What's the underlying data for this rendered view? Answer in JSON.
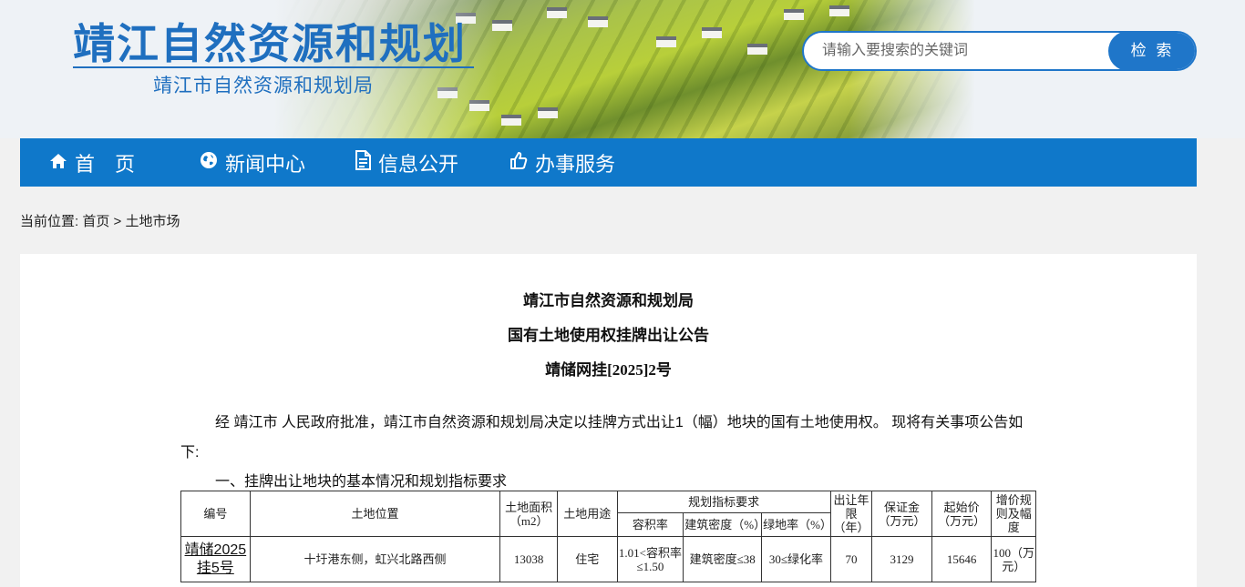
{
  "site": {
    "title": "靖江自然资源和规划",
    "subtitle": "靖江市自然资源和规划局"
  },
  "search": {
    "placeholder": "请输入要搜索的关键词",
    "button": "检 索"
  },
  "nav": {
    "items": [
      {
        "label": "首　页",
        "icon": "home-icon"
      },
      {
        "label": "新闻中心",
        "icon": "globe-icon"
      },
      {
        "label": "信息公开",
        "icon": "document-icon"
      },
      {
        "label": "办事服务",
        "icon": "thumbs-up-icon"
      }
    ]
  },
  "breadcrumb": {
    "prefix": "当前位置:",
    "home": "首页",
    "separator": ">",
    "current": "土地市场"
  },
  "article": {
    "title1": "靖江市自然资源和规划局",
    "title2": "国有土地使用权挂牌出让公告",
    "title3": "靖储网挂[2025]2号",
    "paragraph": "经 靖江市 人民政府批准，靖江市自然资源和规划局决定以挂牌方式出让1（幅）地块的国有土地使用权。 现将有关事项公告如下:",
    "section1": "一、挂牌出让地块的基本情况和规划指标要求"
  },
  "table": {
    "headers": {
      "code": "编号",
      "location": "土地位置",
      "area": "土地面积（m2）",
      "use": "土地用途",
      "planning": "规划指标要求",
      "far": "容积率",
      "density": "建筑密度（%）",
      "green": "绿地率（%）",
      "term": "出让年限（年）",
      "deposit": "保证金（万元）",
      "start_price": "起始价（万元）",
      "increment": "增价规则及幅度"
    },
    "rows": [
      {
        "code": "靖储2025挂5号",
        "location": "十圩港东侧，虹兴北路西侧",
        "area": "13038",
        "use": "住宅",
        "far": "1.01<容积率≤1.50",
        "density": "建筑密度≤38",
        "green": "30≤绿化率",
        "term": "70",
        "deposit": "3129",
        "start_price": "15646",
        "increment": "100（万元）"
      }
    ]
  },
  "colors": {
    "brand_blue": "#0f78ca",
    "logo_blue": "#1f6fbf"
  }
}
